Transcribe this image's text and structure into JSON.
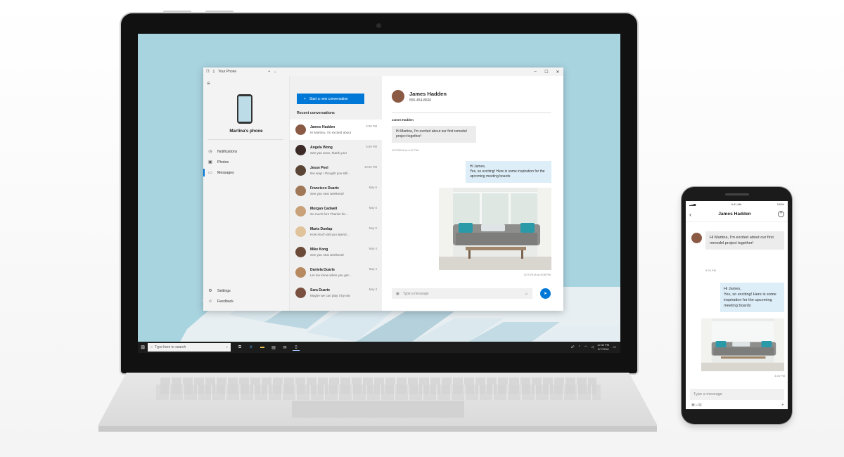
{
  "app": {
    "window_title": "Your Phone",
    "phone_name": "Martina's phone",
    "nav": [
      {
        "label": "Notifications",
        "icon": "bell-icon"
      },
      {
        "label": "Photos",
        "icon": "photo-icon"
      },
      {
        "label": "Messages",
        "icon": "message-icon"
      }
    ],
    "nav_bottom": [
      {
        "label": "Settings",
        "icon": "gear-icon"
      },
      {
        "label": "Feedback",
        "icon": "feedback-icon"
      }
    ],
    "new_conversation_label": "Start a new conversation",
    "recent_heading": "Recent conversations",
    "conversations": [
      {
        "name": "James Hadden",
        "preview": "Hi Martina, I'm excited about",
        "time": "2:28 PM",
        "color": "#8a5a44"
      },
      {
        "name": "Angela Wong",
        "preview": "See you soon, thank you!",
        "time": "5:59 PM",
        "color": "#3b2a26"
      },
      {
        "name": "Jesse Peel",
        "preview": "Nw way! I thought you still...",
        "time": "10:00 PM",
        "color": "#5a4536"
      },
      {
        "name": "Francisco Duarte",
        "preview": "See you next weekend!",
        "time": "May 6",
        "color": "#a07858"
      },
      {
        "name": "Morgan Cadwell",
        "preview": "So much fun! Thanks for...",
        "time": "May 6",
        "color": "#c9a27a"
      },
      {
        "name": "Maria Dunlap",
        "preview": "How much did you spend...",
        "time": "May 6",
        "color": "#e0c39a"
      },
      {
        "name": "Mike Kong",
        "preview": "See you next weekend!",
        "time": "May 4",
        "color": "#6b4a3a"
      },
      {
        "name": "Daniela Duarte",
        "preview": "Let me know when you get...",
        "time": "May 4",
        "color": "#b88a62"
      },
      {
        "name": "Sara Duarte",
        "preview": "Maybe we can play it by ear",
        "time": "May 3",
        "color": "#7a5040"
      }
    ],
    "thread": {
      "contact_name": "James Hadden",
      "contact_number": "555-454-8666",
      "sender_label": "James Hadden",
      "incoming": "Hi Martina, I'm excited about our first remodel project together!",
      "incoming_time": "2/27/2018 at 4:07 PM",
      "outgoing": "Hi James,\nYes, so exciting! Here is some inspiration for the upcoming meeting boards",
      "outgoing_time": "2/27/2018 at 4:08 PM",
      "compose_placeholder": "Type a message"
    }
  },
  "taskbar": {
    "search_placeholder": "Type here to search",
    "time": "12:30 PM",
    "date": "5/7/2018"
  },
  "phone": {
    "status_time": "9:41 AM",
    "battery": "100%",
    "title": "James Hadden",
    "incoming": "Hi Martina, I'm excited about our first remodel project together!",
    "incoming_time": "3:03 PM",
    "outgoing": "Hi James,\nYes, so exciting! Here is some inspiration for the upcoming meeting boards",
    "outgoing_time": "3:05 PM",
    "compose_placeholder": "Type a message"
  },
  "colors": {
    "accent": "#0078d7",
    "desktop": "#a8d4e0"
  }
}
